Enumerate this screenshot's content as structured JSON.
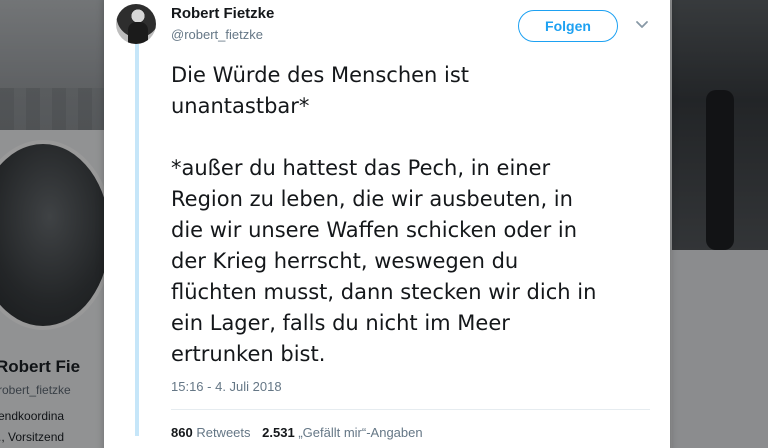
{
  "background_profile": {
    "name": "Robert Fie",
    "handle": "robert_fietzke",
    "bio_line_1": "endkoordina",
    "bio_line_2": "., Vorsitzend"
  },
  "tweet": {
    "author": {
      "name": "Robert Fietzke",
      "handle": "@robert_fietzke",
      "avatar_icon": "profile-photo"
    },
    "follow_label": "Folgen",
    "menu_icon": "chevron-down-icon",
    "text_lines": [
      "Die Würde des Menschen ist",
      "unantastbar*",
      "",
      "*außer du hattest das Pech, in einer",
      "Region zu leben, die wir ausbeuten, in",
      "die wir unsere Waffen schicken oder in",
      "der Krieg herrscht, weswegen du",
      "flüchten musst, dann stecken wir dich in",
      "ein Lager, falls du nicht im Meer",
      "ertrunken bist."
    ],
    "timestamp": "15:16 - 4. Juli 2018",
    "stats": {
      "retweets_count": "860",
      "retweets_label": "Retweets",
      "likes_count": "2.531",
      "likes_label": "„Gefällt mir“-Angaben"
    }
  },
  "colors": {
    "accent": "#1da1f2",
    "text": "#14171a",
    "secondary_text": "#657786",
    "thread_line": "#c6e6f9"
  }
}
